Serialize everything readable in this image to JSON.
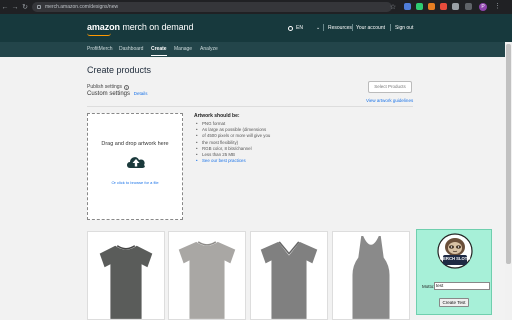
{
  "browser": {
    "url": "merch.amazon.com/designs/new",
    "profile_initial": "P"
  },
  "header": {
    "logo_brand": "amazon",
    "logo_rest": " merch on demand",
    "language": "EN",
    "links": [
      "Resources",
      "Your account",
      "Sign out"
    ]
  },
  "tabs": [
    "ProfitMerch",
    "Dashboard",
    "Create",
    "Manage",
    "Analyze"
  ],
  "active_tab": "Create",
  "main": {
    "title": "Create products",
    "publish_settings": "Publish settings",
    "custom_settings": "Custom settings",
    "custom_settings_link": "Details",
    "select_products": "Select Products",
    "view_guidelines": "View artwork guidelines"
  },
  "upload": {
    "title": "Drag and drop artwork here",
    "browse": "Or click to browse for a file"
  },
  "artwork": {
    "heading": "Artwork should be:",
    "items": [
      "PNG format",
      "As large as possible (dimensions",
      "of 4500 pixels or more will give you",
      "the most flexibility)",
      "RGB color, 8 bits/channel",
      "Less than 25 MB"
    ],
    "link": "See our best practices"
  },
  "products": [
    {
      "name": "standard-tshirt",
      "color": "#5a5c5a"
    },
    {
      "name": "premium-tshirt",
      "color": "#a9a7a4"
    },
    {
      "name": "vneck-tshirt",
      "color": "#808080"
    },
    {
      "name": "tank-top",
      "color": "#8a8a8a"
    }
  ],
  "plugin": {
    "logo_text": "MERCH SLOTH",
    "motto_label": "Motto:",
    "motto_value": "test",
    "create_button": "Create Test"
  },
  "colors": {
    "header_bg": "#17393d",
    "tab_bg": "#23454a",
    "plugin_bg": "#a7f0d8",
    "link": "#1a73e8"
  }
}
